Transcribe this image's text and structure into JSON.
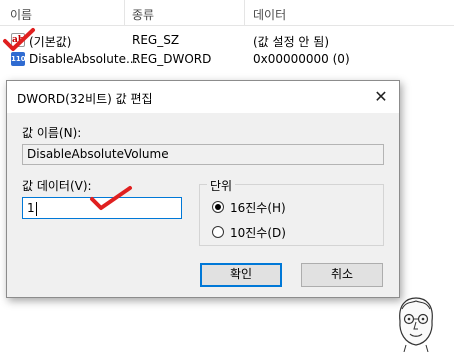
{
  "list": {
    "columns": [
      "이름",
      "종류",
      "데이터"
    ],
    "rows": [
      {
        "icon": "string-value-icon",
        "icon_text": "ab",
        "name": "(기본값)",
        "type": "REG_SZ",
        "data": "(값 설정 안 됨)"
      },
      {
        "icon": "binary-value-icon",
        "icon_text": "110",
        "name": "DisableAbsolute...",
        "type": "REG_DWORD",
        "data": "0x00000000 (0)"
      }
    ]
  },
  "dialog": {
    "title": "DWORD(32비트) 값 편집",
    "close_glyph": "✕",
    "value_name_label": "값 이름(N):",
    "value_name": "DisableAbsoluteVolume",
    "value_data_label": "값 데이터(V):",
    "value_data": "1",
    "base_label": "단위",
    "base_options": [
      {
        "label": "16진수(H)",
        "selected": true
      },
      {
        "label": "10진수(D)",
        "selected": false
      }
    ],
    "ok_label": "확인",
    "cancel_label": "취소"
  },
  "colors": {
    "check_mark": "#e02020",
    "focus_border": "#0078d7"
  }
}
